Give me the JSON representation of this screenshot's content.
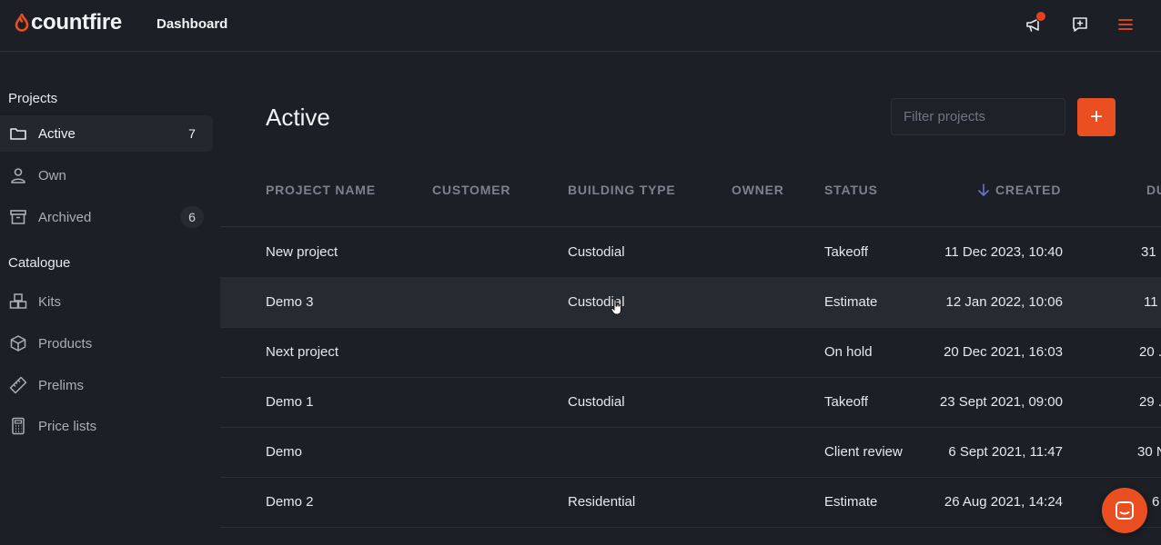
{
  "brand": {
    "name": "countfire",
    "accent": "#ea4f22"
  },
  "nav": {
    "title": "Dashboard"
  },
  "topbar_icons": [
    "megaphone-icon",
    "feedback-icon",
    "menu-icon"
  ],
  "sidebar": {
    "projects_title": "Projects",
    "project_items": [
      {
        "label": "Active",
        "count": "7",
        "icon": "folder-icon"
      },
      {
        "label": "Own",
        "count": "",
        "icon": "user-icon"
      },
      {
        "label": "Archived",
        "count": "6",
        "icon": "archive-icon"
      }
    ],
    "catalogue_title": "Catalogue",
    "catalogue_items": [
      {
        "label": "Kits",
        "icon": "boxes-icon"
      },
      {
        "label": "Products",
        "icon": "cube-icon"
      },
      {
        "label": "Prelims",
        "icon": "ruler-icon"
      },
      {
        "label": "Price lists",
        "icon": "calculator-icon"
      }
    ]
  },
  "main": {
    "title": "Active",
    "filter_placeholder": "Filter projects",
    "add_label": "+",
    "sort_icon": "sort-down-icon",
    "columns": [
      "PROJECT NAME",
      "CUSTOMER",
      "BUILDING TYPE",
      "OWNER",
      "STATUS",
      "CREATED",
      "DU"
    ],
    "rows": [
      {
        "name": "New project",
        "customer": "",
        "building_type": "Custodial",
        "owner": "",
        "status": "Takeoff",
        "created": "11 Dec 2023, 10:40",
        "due": "31 ."
      },
      {
        "name": "Demo 3",
        "customer": "",
        "building_type": "Custodial",
        "owner": "",
        "status": "Estimate",
        "created": "12 Jan 2022, 10:06",
        "due": "11 ."
      },
      {
        "name": "Next project",
        "customer": "",
        "building_type": "",
        "owner": "",
        "status": "On hold",
        "created": "20 Dec 2021, 16:03",
        "due": "20 ."
      },
      {
        "name": "Demo 1",
        "customer": "",
        "building_type": "Custodial",
        "owner": "",
        "status": "Takeoff",
        "created": "23 Sept 2021, 09:00",
        "due": "29 ."
      },
      {
        "name": "Demo",
        "customer": "",
        "building_type": "",
        "owner": "",
        "status": "Client review",
        "created": "6 Sept 2021, 11:47",
        "due": "30 N"
      },
      {
        "name": "Demo 2",
        "customer": "",
        "building_type": "Residential",
        "owner": "",
        "status": "Estimate",
        "created": "26 Aug 2021, 14:24",
        "due": "6"
      }
    ]
  },
  "chat_icon": "chat-icon"
}
